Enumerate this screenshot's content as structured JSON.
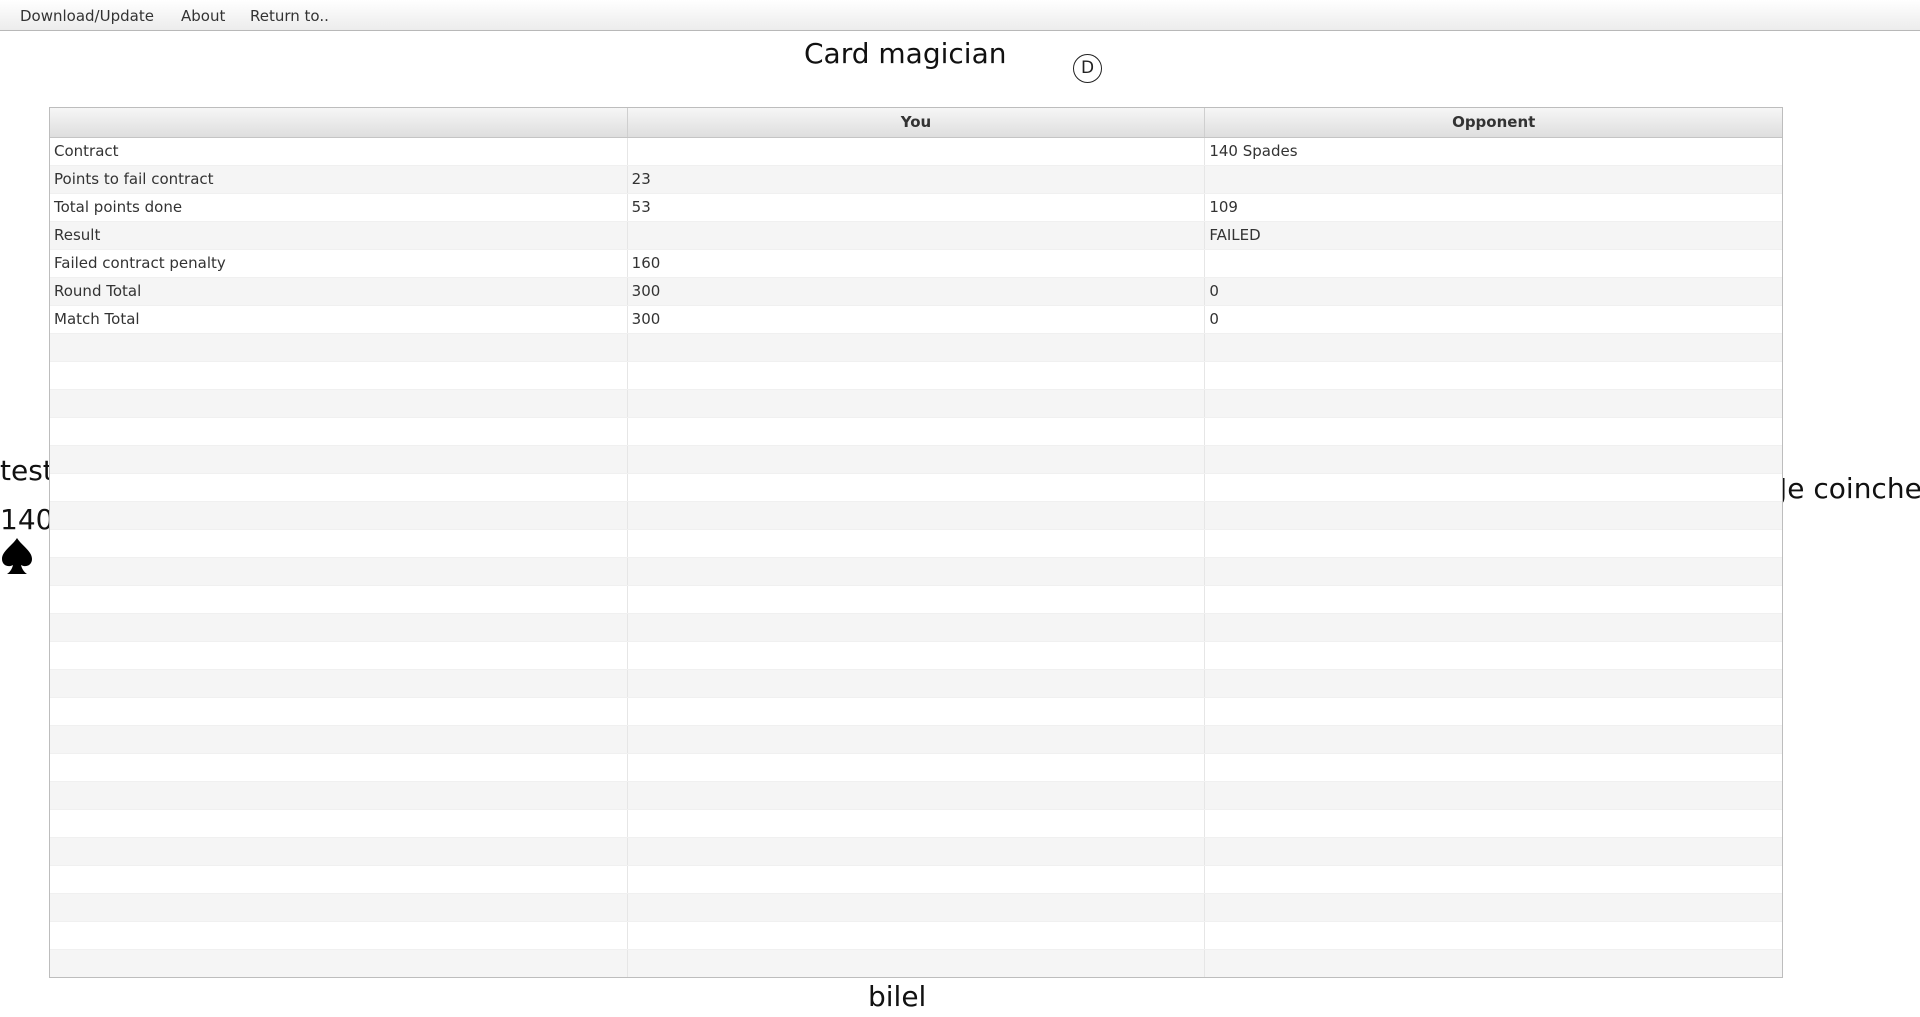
{
  "menu": {
    "items": [
      {
        "label": "Download/Update"
      },
      {
        "label": "About"
      },
      {
        "label": "Return to.."
      }
    ]
  },
  "players": {
    "north": "Card magician",
    "west": "test",
    "east": "Je coinche",
    "south": "bilel"
  },
  "dealer": {
    "label": "D"
  },
  "bid": {
    "value": "140",
    "suit_icon": "spade-icon"
  },
  "table": {
    "columns": [
      "",
      "You",
      "Opponent"
    ],
    "rows": [
      {
        "label": "Contract",
        "you": "",
        "opponent": "140 Spades"
      },
      {
        "label": "Points to fail contract",
        "you": "23",
        "opponent": ""
      },
      {
        "label": "Total points done",
        "you": "53",
        "opponent": "109"
      },
      {
        "label": "Result",
        "you": "",
        "opponent": "FAILED"
      },
      {
        "label": "Failed contract penalty",
        "you": "160",
        "opponent": ""
      },
      {
        "label": "Round Total",
        "you": "300",
        "opponent": "0"
      },
      {
        "label": "Match Total",
        "you": "300",
        "opponent": "0"
      }
    ],
    "empty_rows": 24
  },
  "colors": {
    "row_alt": "#f5f5f5",
    "header_top": "#f6f6f6",
    "header_bottom": "#dedede"
  }
}
